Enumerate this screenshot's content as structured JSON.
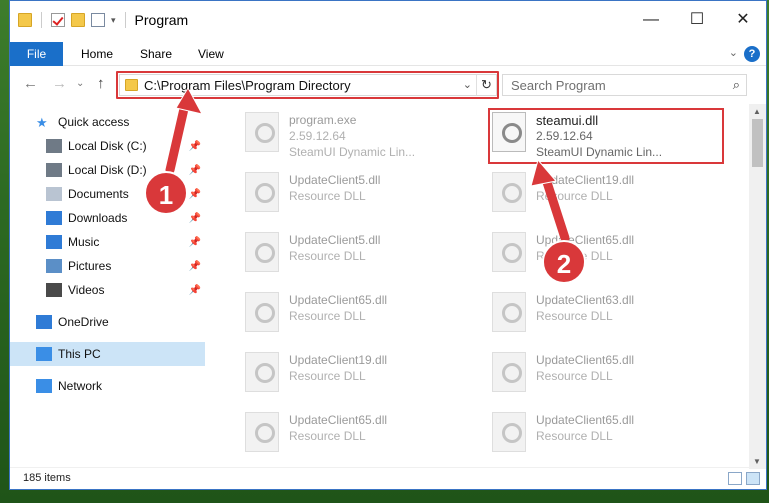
{
  "window": {
    "title": "Program"
  },
  "window_controls": {
    "minimize": "—",
    "maximize": "☐",
    "close": "✕"
  },
  "ribbon": {
    "tabs": [
      "File",
      "Home",
      "Share",
      "View"
    ],
    "help": "?"
  },
  "nav": {
    "back": "←",
    "forward": "→",
    "up": "↑"
  },
  "address": {
    "path": "C:\\Program Files\\Program Directory",
    "dropdown": "⌄",
    "refresh": "↻"
  },
  "search": {
    "placeholder": "Search Program",
    "icon": "⌕"
  },
  "sidebar": {
    "items": [
      {
        "label": "Quick access",
        "icon": "star-icon",
        "pinned": false
      },
      {
        "label": "Local Disk (C:)",
        "icon": "drive-icon",
        "pinned": true
      },
      {
        "label": "Local Disk (D:)",
        "icon": "drive-icon",
        "pinned": true
      },
      {
        "label": "Documents",
        "icon": "documents-icon",
        "pinned": true
      },
      {
        "label": "Downloads",
        "icon": "downloads-icon",
        "pinned": true
      },
      {
        "label": "Music",
        "icon": "music-icon",
        "pinned": true
      },
      {
        "label": "Pictures",
        "icon": "pictures-icon",
        "pinned": true
      },
      {
        "label": "Videos",
        "icon": "videos-icon",
        "pinned": true
      },
      {
        "label": "OneDrive",
        "icon": "cloud-icon",
        "pinned": false
      },
      {
        "label": "This PC",
        "icon": "monitor-icon",
        "pinned": false,
        "selected": true
      },
      {
        "label": "Network",
        "icon": "network-icon",
        "pinned": false
      }
    ],
    "pin_glyph": "📌"
  },
  "files": [
    {
      "name": "program.exe",
      "line2": "2.59.12.64",
      "line3": "SteamUI Dynamic Lin..."
    },
    {
      "name": "steamui.dll",
      "line2": "2.59.12.64",
      "line3": "SteamUI Dynamic Lin..."
    },
    {
      "name": "UpdateClient5.dll",
      "line2": "Resource DLL",
      "line3": ""
    },
    {
      "name": "UpdateClient19.dll",
      "line2": "Resource DLL",
      "line3": ""
    },
    {
      "name": "UpdateClient5.dll",
      "line2": "Resource DLL",
      "line3": ""
    },
    {
      "name": "UpdateClient65.dll",
      "line2": "Resource DLL",
      "line3": ""
    },
    {
      "name": "UpdateClient65.dll",
      "line2": "Resource DLL",
      "line3": ""
    },
    {
      "name": "UpdateClient63.dll",
      "line2": "Resource DLL",
      "line3": ""
    },
    {
      "name": "UpdateClient19.dll",
      "line2": "Resource DLL",
      "line3": ""
    },
    {
      "name": "UpdateClient65.dll",
      "line2": "Resource DLL",
      "line3": ""
    },
    {
      "name": "UpdateClient65.dll",
      "line2": "Resource DLL",
      "line3": ""
    },
    {
      "name": "UpdateClient65.dll",
      "line2": "Resource DLL",
      "line3": ""
    }
  ],
  "status": {
    "count": "185 items"
  },
  "annotations": {
    "badge1": "1",
    "badge2": "2",
    "color": "#d9383a"
  }
}
